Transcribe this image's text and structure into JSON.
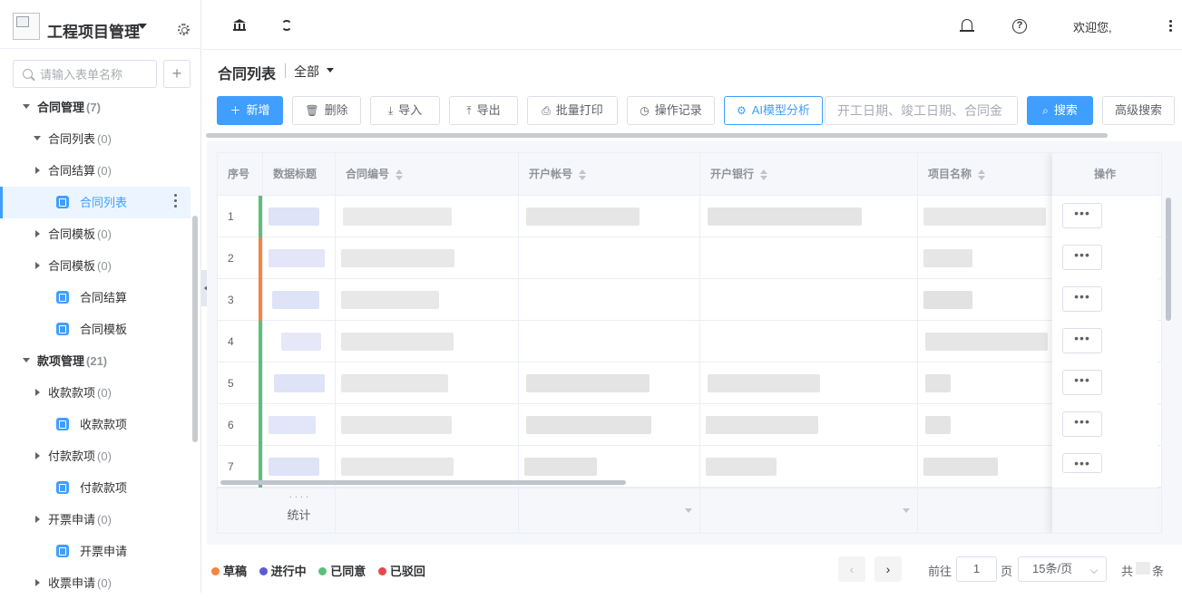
{
  "app": {
    "title": "工程项目管理"
  },
  "sidebar": {
    "search_placeholder": "请输入表单名称",
    "add_label": "+",
    "tree": [
      {
        "label": "合同管理",
        "count": "(7)"
      },
      {
        "label": "合同列表",
        "count": "(0)"
      },
      {
        "label": "合同结算",
        "count": "(0)"
      },
      {
        "label": "合同列表",
        "count": ""
      },
      {
        "label": "合同模板",
        "count": "(0)"
      },
      {
        "label": "合同模板",
        "count": "(0)"
      },
      {
        "label": "合同结算",
        "count": ""
      },
      {
        "label": "合同模板",
        "count": ""
      },
      {
        "label": "款项管理",
        "count": "(21)"
      },
      {
        "label": "收款款项",
        "count": "(0)"
      },
      {
        "label": "收款款项",
        "count": ""
      },
      {
        "label": "付款款项",
        "count": "(0)"
      },
      {
        "label": "付款款项",
        "count": ""
      },
      {
        "label": "开票申请",
        "count": "(0)"
      },
      {
        "label": "开票申请",
        "count": ""
      },
      {
        "label": "收票申请",
        "count": "(0)"
      }
    ]
  },
  "topbar": {
    "welcome": "欢迎您,",
    "help_glyph": "?"
  },
  "page": {
    "title": "合同列表",
    "filter": "全部"
  },
  "toolbar": {
    "add": "新增",
    "delete": "删除",
    "import": "导入",
    "export": "导出",
    "batch_print": "批量打印",
    "op_log": "操作记录",
    "ai": "AI模型分析",
    "date_placeholder": "开工日期、竣工日期、合同金",
    "search": "搜索",
    "advanced": "高级搜索"
  },
  "table": {
    "headers": {
      "idx": "序号",
      "title": "数据标题",
      "contract_no": "合同编号",
      "account": "开户帐号",
      "bank": "开户银行",
      "project": "项目名称",
      "ops": "操作"
    },
    "rows": [
      "1",
      "2",
      "3",
      "4",
      "5",
      "6",
      "7"
    ],
    "summary": "统计",
    "summary_dots": "· · · ·",
    "op_glyph": "•••"
  },
  "legend": [
    {
      "label": "草稿",
      "color": "#f5843d"
    },
    {
      "label": "进行中",
      "color": "#5b5bd6"
    },
    {
      "label": "已同意",
      "color": "#5cbf7a"
    },
    {
      "label": "已驳回",
      "color": "#e8484b"
    }
  ],
  "pagination": {
    "goto": "前往",
    "page": "1",
    "page_unit": "页",
    "size": "15条/页",
    "total_prefix": "共",
    "total_suffix": "条",
    "prev": "‹",
    "next": "›"
  },
  "colors": {
    "accent": "#409eff"
  }
}
